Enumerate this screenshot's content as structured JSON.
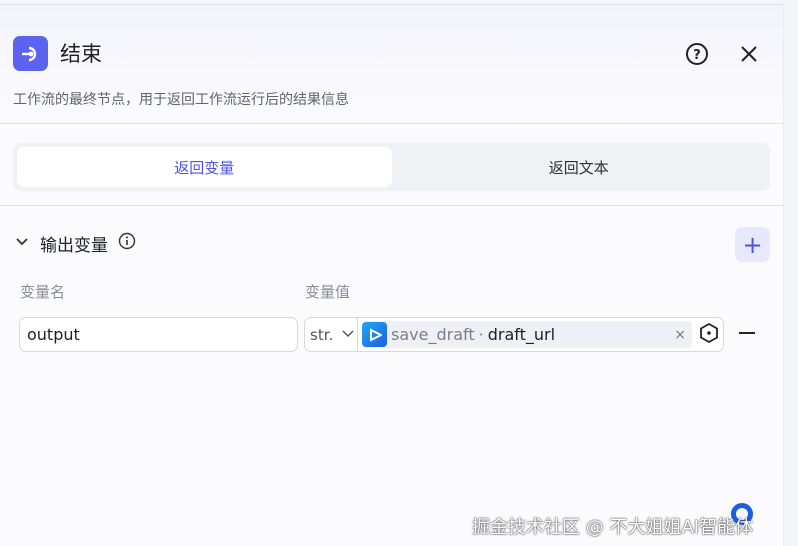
{
  "header": {
    "title": "结束",
    "description": "工作流的最终节点，用于返回工作流运行后的结果信息"
  },
  "tabs": [
    {
      "label": "返回变量",
      "active": true
    },
    {
      "label": "返回文本",
      "active": false
    }
  ],
  "section": {
    "title": "输出变量",
    "col_name": "变量名",
    "col_value": "变量值"
  },
  "rows": [
    {
      "name": "output",
      "type": "str.",
      "ref_node": "save_draft",
      "ref_sep": "·",
      "ref_field": "draft_url"
    }
  ],
  "watermark": "掘金技术社区 @ 不大姐姐AI智能体",
  "colors": {
    "accent": "#4d53e8",
    "logo": "#5b63f0"
  }
}
